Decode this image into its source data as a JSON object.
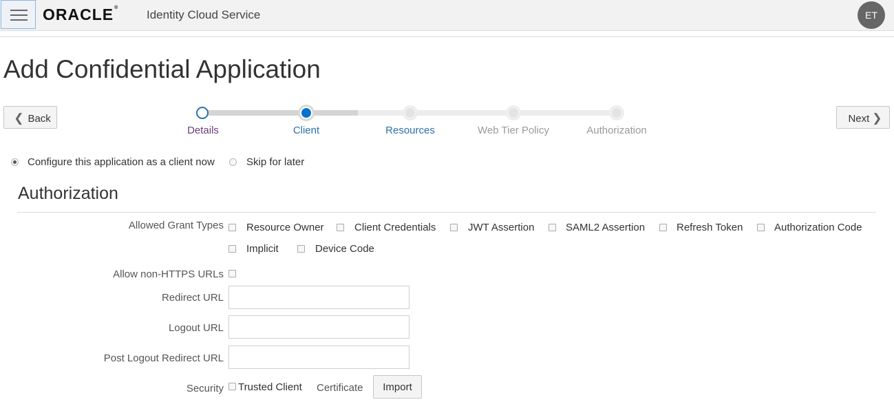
{
  "header": {
    "menu_icon": "hamburger-menu-icon",
    "logo_text": "ORACLE",
    "logo_mark": "®",
    "app_title": "Identity Cloud Service",
    "avatar_initials": "ET"
  },
  "page": {
    "title": "Add Confidential Application"
  },
  "navigation": {
    "back_label": "Back",
    "back_icon": "chevron-left-icon",
    "next_label": "Next",
    "next_icon": "chevron-right-icon"
  },
  "train": {
    "steps": [
      {
        "label": "Details",
        "state": "visited",
        "color": "#6b3d7a"
      },
      {
        "label": "Client",
        "state": "current",
        "color": "#2e6fad"
      },
      {
        "label": "Resources",
        "state": "enabled",
        "color": "#2e6fad"
      },
      {
        "label": "Web Tier Policy",
        "state": "disabled",
        "color": "#9a9a9a"
      },
      {
        "label": "Authorization",
        "state": "disabled",
        "color": "#9a9a9a"
      }
    ]
  },
  "client_config": {
    "options": [
      {
        "label": "Configure this application as a client now",
        "checked": true
      },
      {
        "label": "Skip for later",
        "checked": false
      }
    ]
  },
  "authorization": {
    "section_title": "Authorization",
    "grant_types_label": "Allowed Grant Types",
    "grant_types": [
      {
        "label": "Resource Owner",
        "checked": false
      },
      {
        "label": "Client Credentials",
        "checked": false
      },
      {
        "label": "JWT Assertion",
        "checked": false
      },
      {
        "label": "SAML2 Assertion",
        "checked": false
      },
      {
        "label": "Refresh Token",
        "checked": false
      },
      {
        "label": "Authorization Code",
        "checked": false
      },
      {
        "label": "Implicit",
        "checked": false
      },
      {
        "label": "Device Code",
        "checked": false
      }
    ],
    "allow_non_https_label": "Allow non-HTTPS URLs",
    "allow_non_https_checked": false,
    "redirect_url_label": "Redirect URL",
    "redirect_url_value": "",
    "logout_url_label": "Logout URL",
    "logout_url_value": "",
    "post_logout_redirect_url_label": "Post Logout Redirect URL",
    "post_logout_redirect_url_value": "",
    "security_label": "Security",
    "trusted_client_label": "Trusted Client",
    "trusted_client_checked": false,
    "certificate_label": "Certificate",
    "import_label": "Import"
  },
  "colors": {
    "accent": "#0572ce",
    "header_bg": "#f2f2f2",
    "avatar_bg": "#666666"
  }
}
